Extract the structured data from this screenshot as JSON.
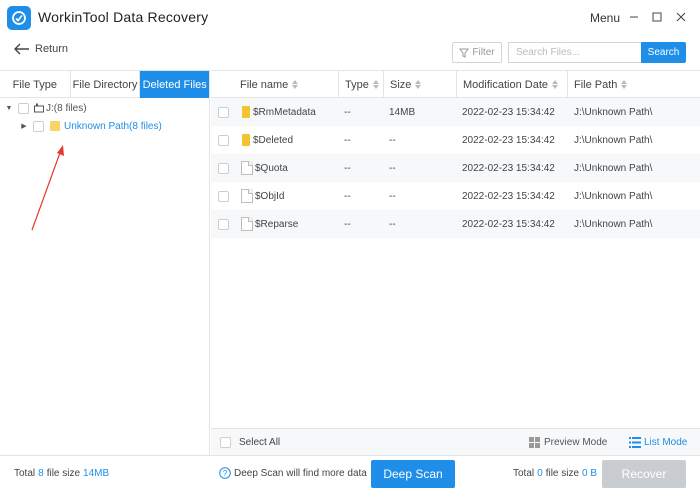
{
  "window": {
    "title": "WorkinTool Data Recovery",
    "menu_label": "Menu"
  },
  "toolbar": {
    "return_label": "Return",
    "filter_label": "Filter",
    "search_placeholder": "Search Files...",
    "search_button": "Search"
  },
  "left_tabs": [
    {
      "label": "File Type",
      "active": false
    },
    {
      "label": "File Directory",
      "active": false
    },
    {
      "label": "Deleted Files",
      "active": true
    }
  ],
  "tree": {
    "drive": {
      "label": "J:(8 files)",
      "expanded": true
    },
    "child": {
      "label": "Unknown Path(8 files)",
      "expanded": false
    }
  },
  "table": {
    "columns": [
      "File name",
      "Type",
      "Size",
      "Modification Date",
      "File Path"
    ],
    "rows": [
      {
        "icon": "folder-icon",
        "name": "$RmMetadata",
        "type": "--",
        "size": "14MB",
        "date": "2022-02-23 15:34:42",
        "path": "J:\\Unknown Path\\"
      },
      {
        "icon": "folder-icon",
        "name": "$Deleted",
        "type": "--",
        "size": "--",
        "date": "2022-02-23 15:34:42",
        "path": "J:\\Unknown Path\\"
      },
      {
        "icon": "document-icon",
        "name": "$Quota",
        "type": "--",
        "size": "--",
        "date": "2022-02-23 15:34:42",
        "path": "J:\\Unknown Path\\"
      },
      {
        "icon": "document-icon",
        "name": "$ObjId",
        "type": "--",
        "size": "--",
        "date": "2022-02-23 15:34:42",
        "path": "J:\\Unknown Path\\"
      },
      {
        "icon": "document-icon",
        "name": "$Reparse",
        "type": "--",
        "size": "--",
        "date": "2022-02-23 15:34:42",
        "path": "J:\\Unknown Path\\"
      }
    ]
  },
  "bottom_bar": {
    "select_all": "Select All",
    "preview_mode": "Preview Mode",
    "list_mode": "List Mode"
  },
  "footer": {
    "total_prefix": "Total",
    "total_count": "8",
    "file_size_label": "file size",
    "total_size": "14MB",
    "deep_scan_hint": "Deep Scan will find more data",
    "deep_scan_button": "Deep Scan",
    "selected_count": "0",
    "selected_size": "0 B",
    "recover_button": "Recover"
  },
  "colors": {
    "accent": "#1e8ee8",
    "annotation_arrow": "#e53935",
    "disabled_button": "#c9ccd1"
  }
}
